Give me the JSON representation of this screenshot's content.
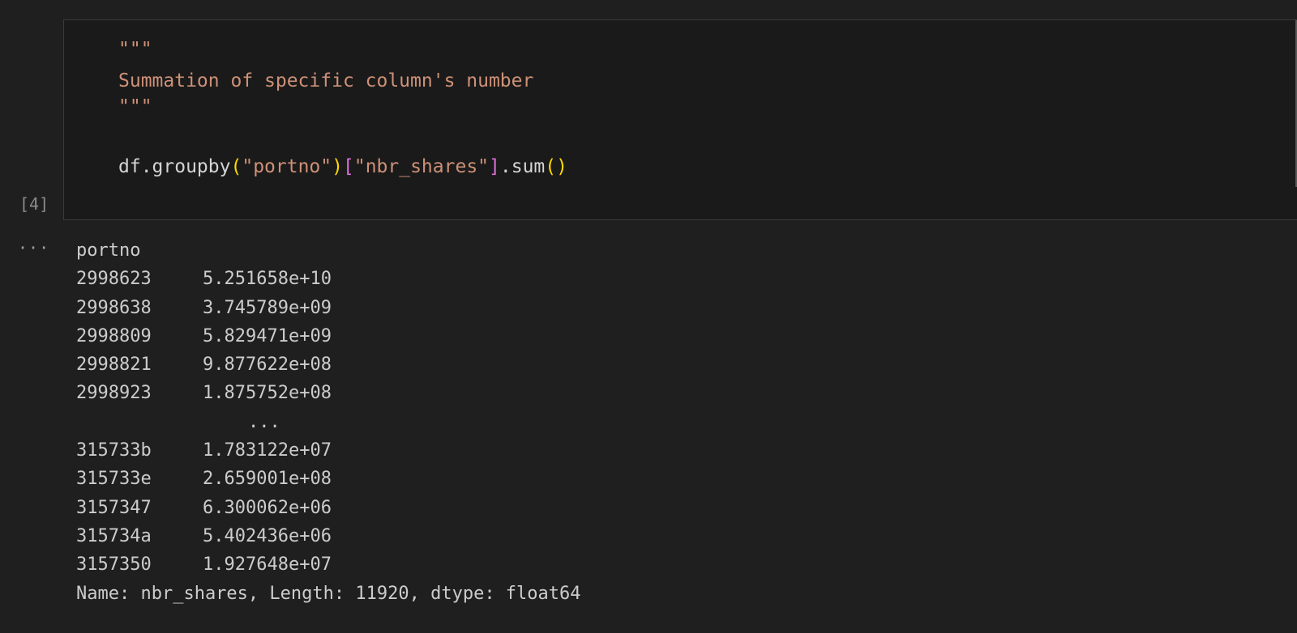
{
  "cell": {
    "execution_count": "[4]",
    "code": {
      "docstring_open": "\"\"\"",
      "docstring_text": "Summation of specific column's number",
      "docstring_close": "\"\"\"",
      "call_prefix": "df.groupby",
      "paren_open": "(",
      "arg_groupby": "\"portno\"",
      "paren_close": ")",
      "bracket_open": "[",
      "arg_column": "\"nbr_shares\"",
      "bracket_close": "]",
      "method": ".sum",
      "call_parens": "()"
    }
  },
  "output": {
    "menu_label": "···",
    "header": "portno",
    "rows": [
      {
        "index": "2998623",
        "value": "5.251658e+10"
      },
      {
        "index": "2998638",
        "value": "3.745789e+09"
      },
      {
        "index": "2998809",
        "value": "5.829471e+09"
      },
      {
        "index": "2998821",
        "value": "9.877622e+08"
      },
      {
        "index": "2998923",
        "value": "1.875752e+08"
      }
    ],
    "ellipsis": "...",
    "rows_tail": [
      {
        "index": "315733b",
        "value": "1.783122e+07"
      },
      {
        "index": "315733e",
        "value": "2.659001e+08"
      },
      {
        "index": "3157347",
        "value": "6.300062e+06"
      },
      {
        "index": "315734a",
        "value": "5.402436e+06"
      },
      {
        "index": "3157350",
        "value": "1.927648e+07"
      }
    ],
    "footer": "Name: nbr_shares, Length: 11920, dtype: float64"
  }
}
